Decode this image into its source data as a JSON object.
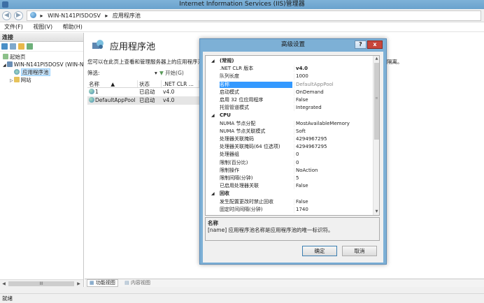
{
  "window": {
    "title": "Internet Information Services (IIS)管理器"
  },
  "address": {
    "crumbs": [
      "WIN-N141PI5DOSV",
      "应用程序池"
    ]
  },
  "menu": {
    "items": [
      "文件(F)",
      "视图(V)",
      "帮助(H)"
    ]
  },
  "connections": {
    "header": "连接",
    "tree": [
      {
        "label": "起始页",
        "indent": 0,
        "icon": "start-page-icon"
      },
      {
        "label": "WIN-N141PI5DOSV (WIN-N",
        "indent": 1,
        "icon": "server-icon"
      },
      {
        "label": "应用程序池",
        "indent": 2,
        "icon": "app-pool-icon",
        "selected": true
      },
      {
        "label": "网站",
        "indent": 2,
        "icon": "folder-icon"
      }
    ],
    "scrollbar_grip": "III"
  },
  "main": {
    "title": "应用程序池",
    "description": "您可以在此页上查看和管理服务器上的应用程序池",
    "description_right": "序之间的隔离。",
    "filter_label": "筛选:",
    "filter_go": "开始(G)",
    "columns": [
      "名称",
      "状态",
      ".NET CLR ..."
    ],
    "rows": [
      {
        "name": "1",
        "status": "已启动",
        "clr": "v4.0"
      },
      {
        "name": "DefaultAppPool",
        "status": "已启动",
        "clr": "v4.0",
        "selected": true
      }
    ],
    "tabs": [
      "功能视图",
      "内容视图"
    ]
  },
  "status": {
    "text": "就绪"
  },
  "dialog": {
    "title": "高级设置",
    "help_label": "?",
    "close_label": "x",
    "properties": [
      {
        "type": "cat",
        "key": "(常规)"
      },
      {
        "key": ".NET CLR 版本",
        "value": "v4.0",
        "bold": true
      },
      {
        "key": "队列长度",
        "value": "1000"
      },
      {
        "key": "名称",
        "value": "DefaultAppPool",
        "selected": true
      },
      {
        "key": "启动模式",
        "value": "OnDemand"
      },
      {
        "key": "启用 32 位应用程序",
        "value": "False"
      },
      {
        "key": "托管管道模式",
        "value": "Integrated"
      },
      {
        "type": "cat",
        "key": "CPU"
      },
      {
        "key": "NUMA 节点分配",
        "value": "MostAvailableMemory"
      },
      {
        "key": "NUMA 节点关联模式",
        "value": "Soft"
      },
      {
        "key": "处理器关联掩码",
        "value": "4294967295"
      },
      {
        "key": "处理器关联掩码(64 位选项)",
        "value": "4294967295"
      },
      {
        "key": "处理器组",
        "value": "0"
      },
      {
        "key": "限制(百分比)",
        "value": "0"
      },
      {
        "key": "限制操作",
        "value": "NoAction"
      },
      {
        "key": "限制间隔(分钟)",
        "value": "5"
      },
      {
        "key": "已启用处理器关联",
        "value": "False"
      },
      {
        "type": "cat",
        "key": "回收"
      },
      {
        "key": "发生配置更改时禁止回收",
        "value": "False"
      },
      {
        "key": "固定时间间隔(分钟)",
        "value": "1740"
      }
    ],
    "desc_title": "名称",
    "desc_text": "[name] 应用程序池名称是应用程序池的唯一标识符。",
    "ok_label": "确定",
    "cancel_label": "取消"
  }
}
